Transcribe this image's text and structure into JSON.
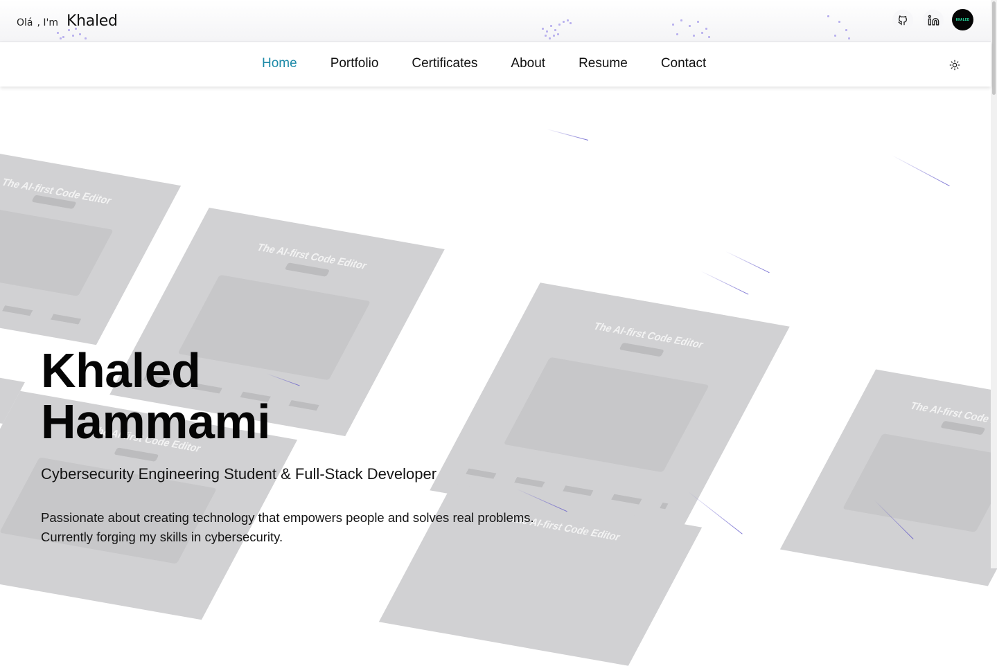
{
  "header": {
    "greeting": "Olá",
    "intro": ", I'm",
    "name": "Khaled",
    "github_icon": "github-icon",
    "linkedin_icon": "linkedin-icon",
    "logo_text": "KHALED"
  },
  "nav": {
    "items": [
      {
        "label": "Home",
        "active": true
      },
      {
        "label": "Portfolio",
        "active": false
      },
      {
        "label": "Certificates",
        "active": false
      },
      {
        "label": "About",
        "active": false
      },
      {
        "label": "Resume",
        "active": false
      },
      {
        "label": "Contact",
        "active": false
      }
    ],
    "theme_icon": "sun-icon"
  },
  "hero": {
    "first_name": "Khaled",
    "last_name": "Hammami",
    "role": "Cybersecurity Engineering Student & Full-Stack Developer",
    "description_line1": "Passionate about creating technology that empowers people and solves real problems.",
    "description_line2": "Currently forging my skills in cybersecurity."
  },
  "background": {
    "card_title": "The AI-first Code Editor"
  },
  "colors": {
    "accent": "#1d8aa8",
    "text": "#0a0a0a",
    "card": "#d1d1d3",
    "logo_text": "#27e3a4"
  }
}
